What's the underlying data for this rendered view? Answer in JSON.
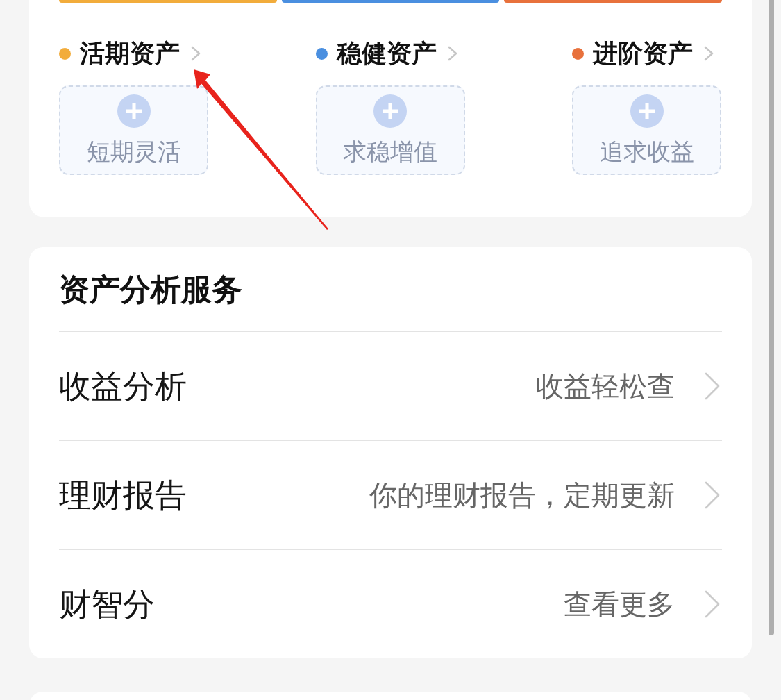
{
  "asset_categories": [
    {
      "title": "活期资产",
      "color": "#f2ac3b",
      "add_label": "短期灵活"
    },
    {
      "title": "稳健资产",
      "color": "#4a8fe0",
      "add_label": "求稳增值"
    },
    {
      "title": "进阶资产",
      "color": "#e8713c",
      "add_label": "追求收益"
    }
  ],
  "analysis_section": {
    "title": "资产分析服务",
    "items": [
      {
        "label": "收益分析",
        "detail": "收益轻松查"
      },
      {
        "label": "理财报告",
        "detail": "你的理财报告，定期更新"
      },
      {
        "label": "财智分",
        "detail": "查看更多"
      }
    ]
  }
}
